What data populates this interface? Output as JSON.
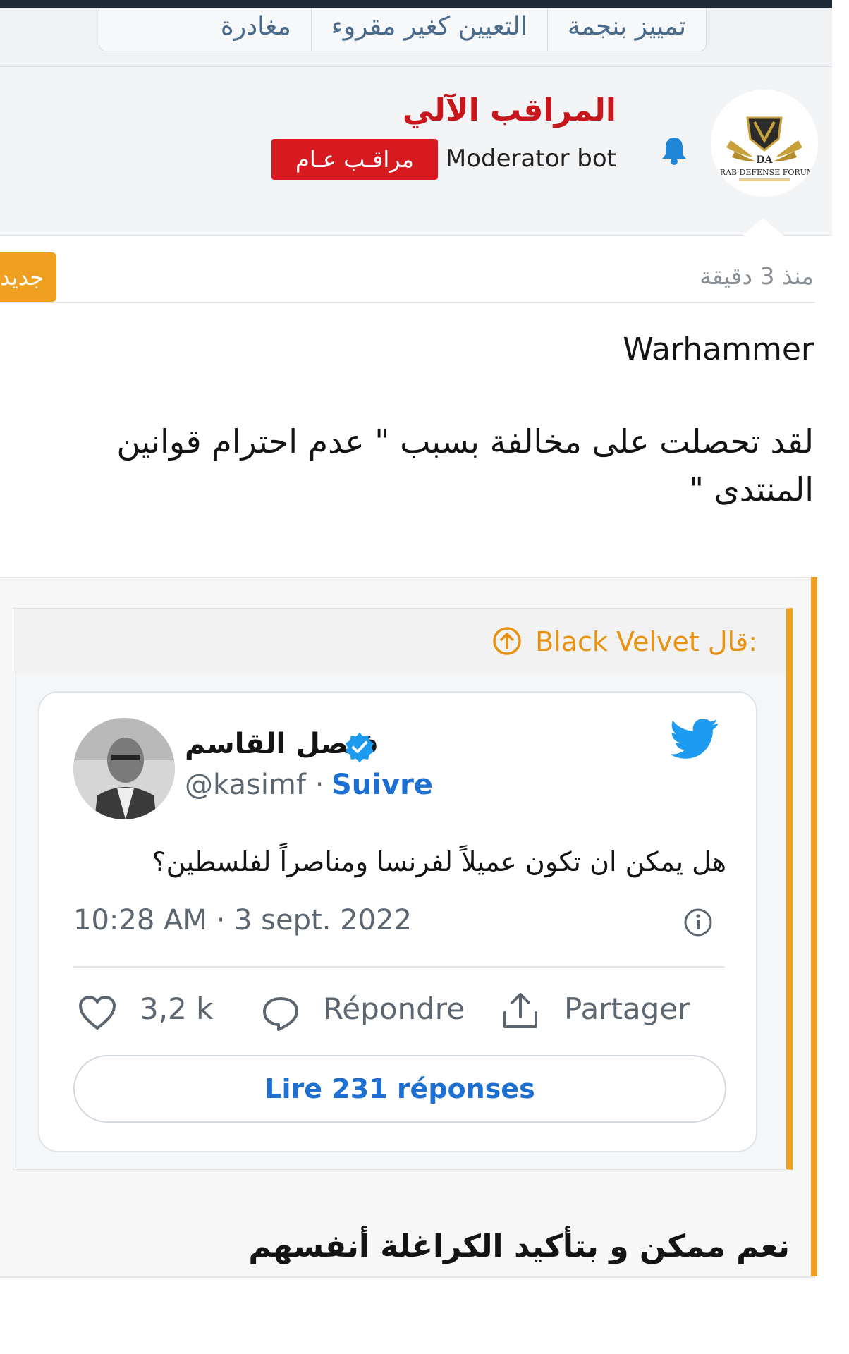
{
  "actions": {
    "star": "تمييز بنجمة",
    "mark_unread": "التعيين كغير مقروء",
    "leave": "مغادرة"
  },
  "user": {
    "name": "المراقب الآلي",
    "title": "Moderator bot",
    "badge": "مراقـب عـام",
    "avatar_alt": "ARAB DEFENSE FORUM"
  },
  "post": {
    "time": "منذ 3 دقيقة",
    "new_badge": "جديد",
    "title": "Warhammer",
    "body": "لقد تحصلت على مخالفة بسبب \" عدم احترام قوانين المنتدى \"",
    "reply": "نعم ممكن و بتأكيد الكراغلة أنفسهم"
  },
  "quote": {
    "attribution": "Black Velvet قال:"
  },
  "tweet": {
    "name": "فيصل القاسم",
    "handle": "@kasimf",
    "separator": " · ",
    "follow": "Suivre",
    "text": "هل يمكن ان تكون عميلاً لفرنسا ومناصراً لفلسطين؟",
    "date": "10:28 AM · 3 sept. 2022",
    "likes": "3,2 k",
    "reply_label": "Répondre",
    "share_label": "Partager",
    "read_replies": "Lire 231 réponses"
  },
  "colors": {
    "username": "#c8171c",
    "badge_bg": "#d71920",
    "accent_orange": "#f0a020",
    "twitter_blue": "#1d9bf0",
    "link_blue": "#1d6fd1",
    "bell_blue": "#1f86d8"
  },
  "icons": [
    "bell-icon",
    "verified-icon",
    "twitter-bird-icon",
    "info-icon",
    "heart-icon",
    "reply-bubble-icon",
    "share-icon",
    "quote-up-arrow-icon"
  ]
}
